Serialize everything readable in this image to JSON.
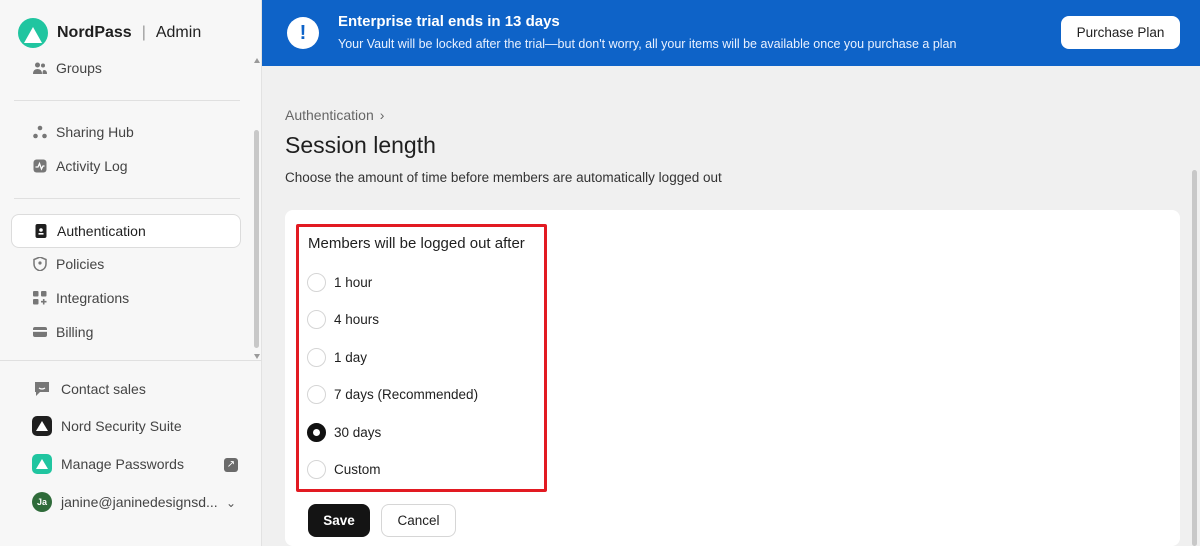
{
  "brand": {
    "name": "NordPass",
    "section": "Admin"
  },
  "sidebar": {
    "items": [
      {
        "label": "Groups",
        "icon": "groups-icon"
      },
      {
        "label": "Sharing Hub",
        "icon": "sharing-hub-icon"
      },
      {
        "label": "Activity Log",
        "icon": "activity-log-icon"
      },
      {
        "label": "Authentication",
        "icon": "authentication-icon",
        "active": true
      },
      {
        "label": "Policies",
        "icon": "policies-icon"
      },
      {
        "label": "Integrations",
        "icon": "integrations-icon"
      },
      {
        "label": "Billing",
        "icon": "billing-icon"
      }
    ],
    "bottom": {
      "contact_sales": "Contact sales",
      "suite": "Nord Security Suite",
      "manage_passwords": "Manage Passwords",
      "user_initials": "Ja",
      "user_email": "janine@janinedesignsd..."
    }
  },
  "banner": {
    "title": "Enterprise trial ends in 13 days",
    "subtitle": "Your Vault will be locked after the trial—but don't worry, all your items will be available once you purchase a plan",
    "button": "Purchase Plan",
    "color": "#0e63c8"
  },
  "main": {
    "breadcrumb": "Authentication",
    "title": "Session length",
    "description": "Choose the amount of time before members are automatically logged out",
    "group_label": "Members will be logged out after",
    "options": [
      {
        "label": "1 hour",
        "checked": false
      },
      {
        "label": "4 hours",
        "checked": false
      },
      {
        "label": "1 day",
        "checked": false
      },
      {
        "label": "7 days (Recommended)",
        "checked": false
      },
      {
        "label": "30 days",
        "checked": true
      },
      {
        "label": "Custom",
        "checked": false
      }
    ],
    "save": "Save",
    "cancel": "Cancel"
  }
}
